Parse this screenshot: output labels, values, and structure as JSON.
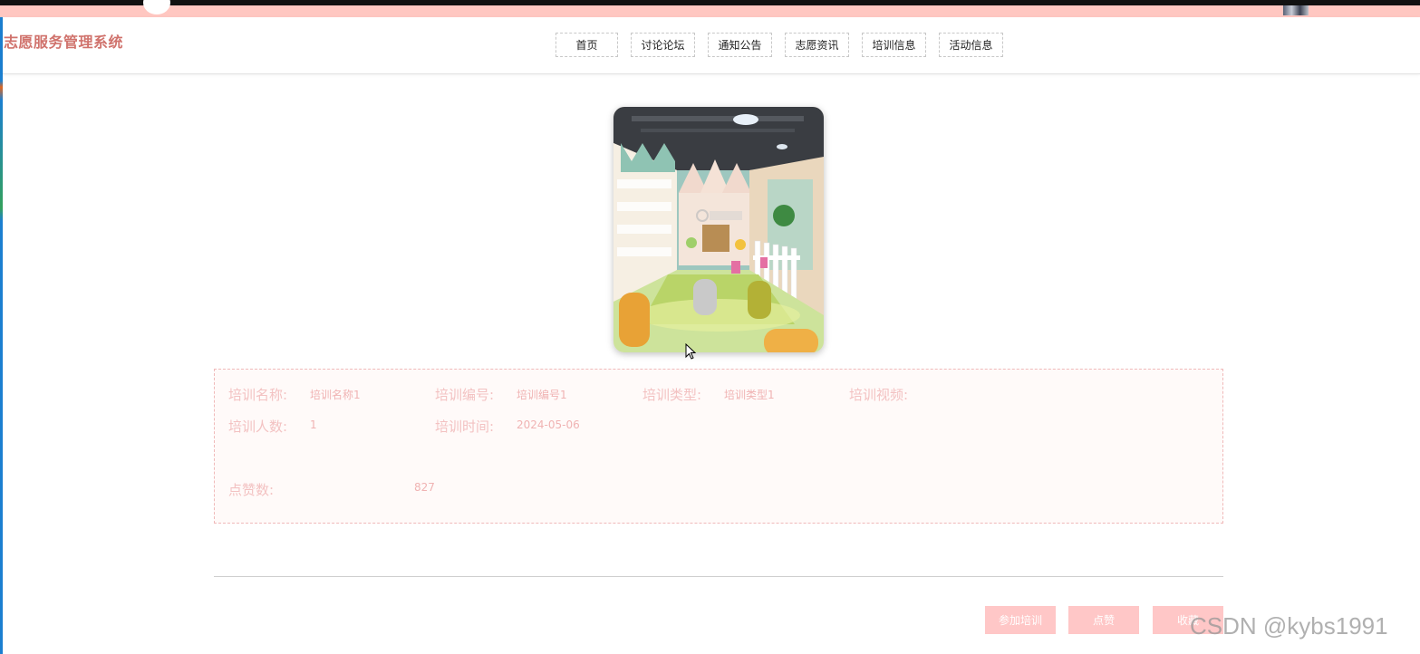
{
  "header": {
    "logo": "志愿服务管理系统",
    "nav": [
      "首页",
      "讨论论坛",
      "通知公告",
      "志愿资讯",
      "培训信息",
      "活动信息"
    ]
  },
  "detail": {
    "image_name": "classroom-photo",
    "fields": {
      "name_label": "培训名称:",
      "name_value": "培训名称1",
      "code_label": "培训编号:",
      "code_value": "培训编号1",
      "type_label": "培训类型:",
      "type_value": "培训类型1",
      "video_label": "培训视频:",
      "count_label": "培训人数:",
      "count_value": "1",
      "time_label": "培训时间:",
      "time_value": "2024-05-06",
      "likes_label": "点赞数:",
      "likes_value": "827"
    }
  },
  "actions": {
    "join": "参加培训",
    "like": "点赞",
    "collect": "收藏"
  },
  "watermark": "CSDN @kybs1991",
  "colors": {
    "accent": "#d0726c",
    "pink": "#ffc7c7",
    "label": "#f3c2c2"
  }
}
